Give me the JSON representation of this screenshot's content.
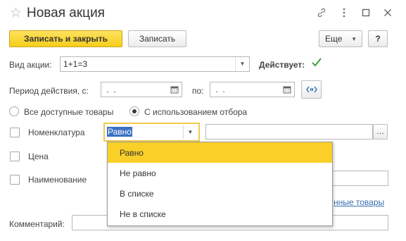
{
  "window": {
    "title": "Новая акция",
    "icons": {
      "favorite": "star-icon",
      "link": "link-icon",
      "more": "more-vertical-icon",
      "maximize": "maximize-icon",
      "close": "close-icon"
    }
  },
  "toolbar": {
    "save_close_label": "Записать и закрыть",
    "save_label": "Записать",
    "more_label": "Еще",
    "help_label": "?"
  },
  "form": {
    "promo_type_label": "Вид акции:",
    "promo_type_value": "1+1=3",
    "active_label": "Действует:",
    "active_checked": true,
    "period_label": "Период действия, с:",
    "period_from_value": " .  .",
    "period_to_label": "по:",
    "period_to_value": " .  .",
    "radio_all_label": "Все доступные товары",
    "radio_filter_label": "С использованием отбора",
    "radio_selected": "filter",
    "nomenclature_label": "Номенклатура",
    "nomenclature_condition": "Равно",
    "nomenclature_value": "",
    "price_label": "Цена",
    "name_label": "Наименование",
    "name_value": "",
    "selected_goods_link": "нные товары",
    "comment_label": "Комментарий:",
    "comment_value": ""
  },
  "condition_popup": {
    "items": [
      "Равно",
      "Не равно",
      "В списке",
      "Не в списке"
    ],
    "selected_index": 0
  },
  "colors": {
    "accent_yellow": "#f9cf28",
    "check_green": "#3aa33a",
    "selection_blue": "#3a6fc4",
    "link_blue": "#3a6fb0"
  }
}
